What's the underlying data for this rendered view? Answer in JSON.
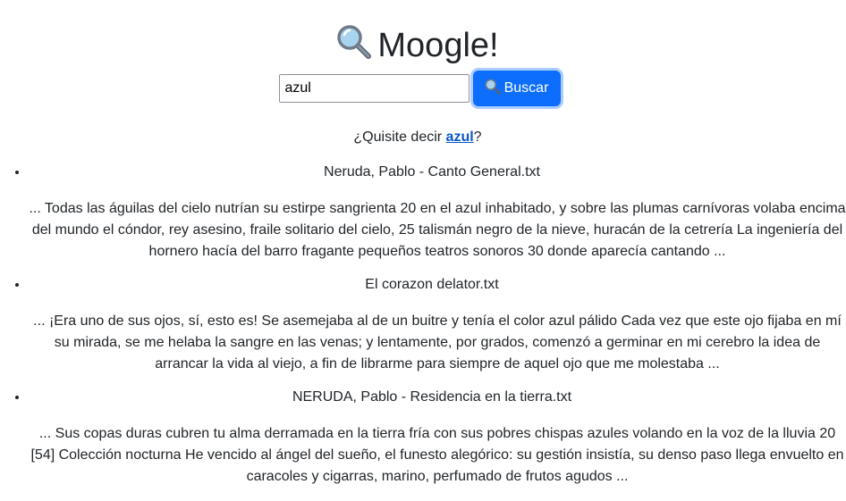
{
  "header": {
    "logo_icon": "magnifying-glass-icon",
    "title": "Moogle!"
  },
  "search": {
    "value": "azul",
    "button_icon": "magnifying-glass-icon",
    "button_label": "Buscar"
  },
  "suggestion": {
    "prefix": "¿Quisite decir ",
    "word": "azul",
    "suffix": "?"
  },
  "results": [
    {
      "title": "Neruda, Pablo - Canto General.txt",
      "snippet": "... Todas las águilas del cielo nutrían su estirpe sangrienta 20 en el azul inhabitado, y sobre las plumas carnívoras volaba encima del mundo el cóndor, rey asesino, fraile solitario del cielo, 25 talismán negro de la nieve, huracán de la cetrería La ingeniería del hornero hacía del barro fragante pequeños teatros sonoros 30 donde aparecía cantando ..."
    },
    {
      "title": "El corazon delator.txt",
      "snippet": "... ¡Era uno de sus ojos, sí, esto es! Se asemejaba al de un buitre y tenía el color azul pálido Cada vez que este ojo fijaba en mí su mirada, se me helaba la sangre en las venas; y lentamente, por grados, comenzó a germinar en mi cerebro la idea de arrancar la vida al viejo, a fin de librarme para siempre de aquel ojo que me molestaba ..."
    },
    {
      "title": "NERUDA, Pablo - Residencia en la tierra.txt",
      "snippet": "... Sus copas duras cubren tu alma derramada en la tierra fría con sus pobres chispas azules volando en la voz de la lluvia 20 [54] Colección nocturna He vencido al ángel del sueño, el funesto alegórico: su gestión insistía, su denso paso llega envuelto en caracoles y cigarras, marino, perfumado de frutos agudos ..."
    }
  ],
  "colors": {
    "button_primary": "#0d6efd",
    "link": "#0a58ca",
    "text": "#212529"
  }
}
